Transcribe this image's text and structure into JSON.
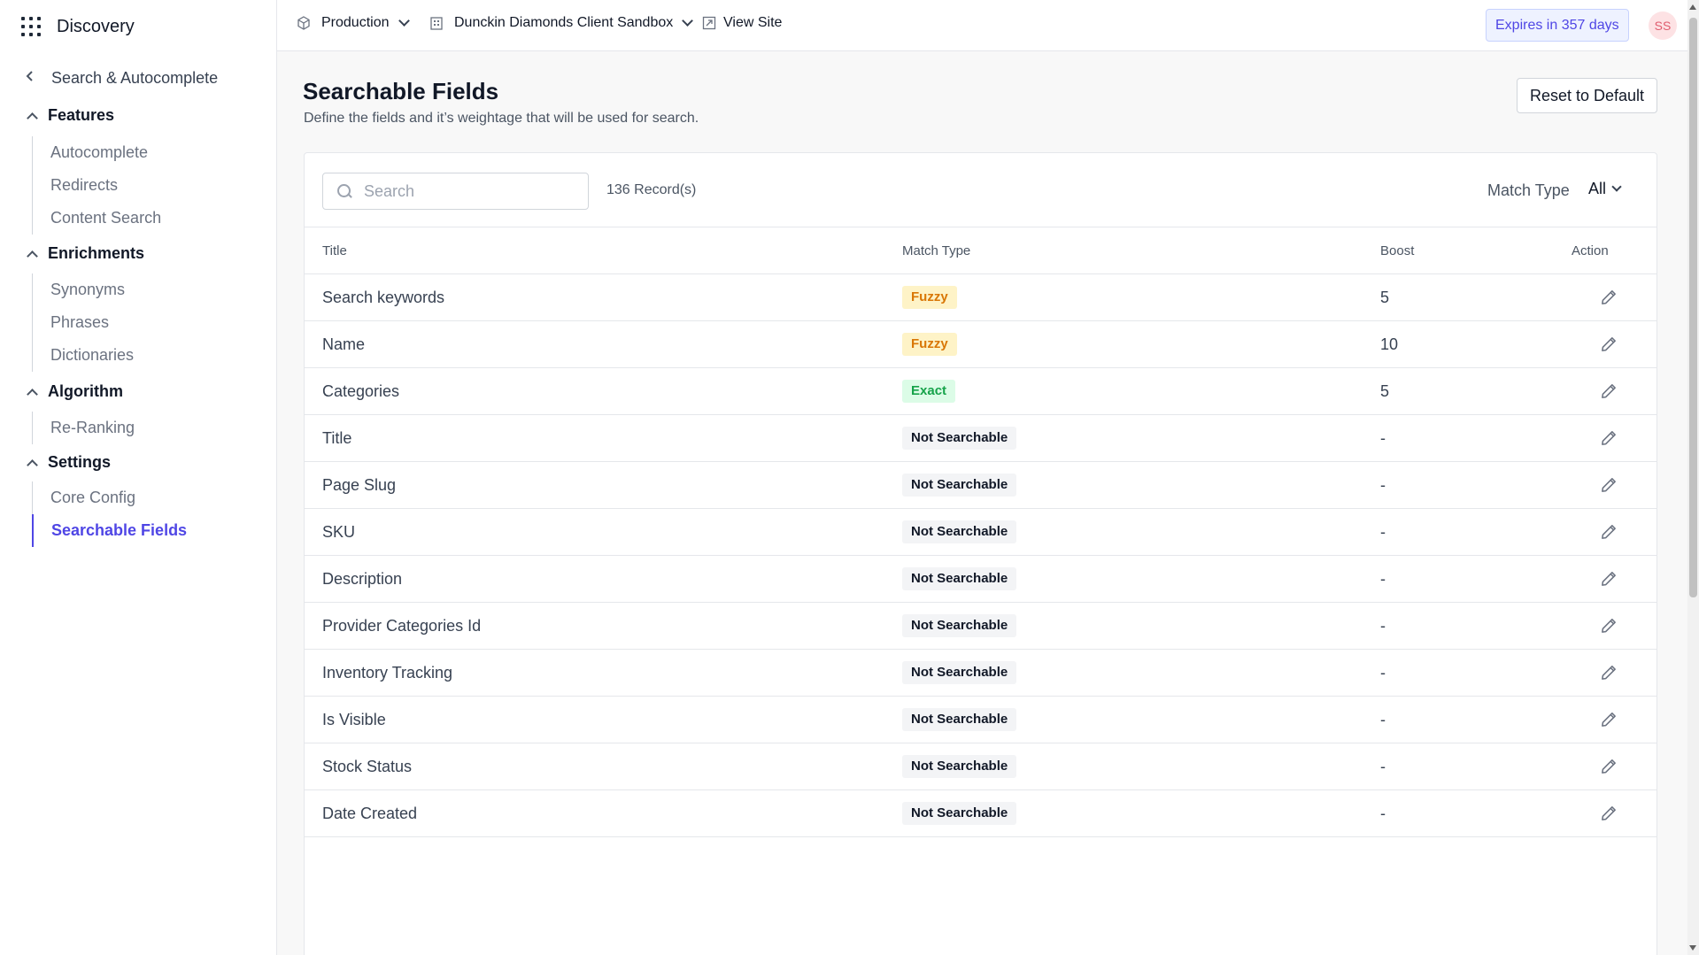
{
  "app": {
    "name": "Discovery"
  },
  "sidebar": {
    "back_label": "Search & Autocomplete",
    "sections": [
      {
        "label": "Features",
        "items": [
          "Autocomplete",
          "Redirects",
          "Content Search"
        ]
      },
      {
        "label": "Enrichments",
        "items": [
          "Synonyms",
          "Phrases",
          "Dictionaries"
        ]
      },
      {
        "label": "Algorithm",
        "items": [
          "Re-Ranking"
        ]
      },
      {
        "label": "Settings",
        "items": [
          "Core Config",
          "Searchable Fields"
        ]
      }
    ],
    "active_item": "Searchable Fields"
  },
  "topbar": {
    "environment": "Production",
    "client": "Dunckin Diamonds Client Sandbox",
    "view_site": "View Site",
    "expires": "Expires in 357 days",
    "avatar_initials": "SS"
  },
  "page": {
    "title": "Searchable Fields",
    "subtitle": "Define the fields and it’s weightage that will be used for search.",
    "reset_label": "Reset to Default"
  },
  "toolbar": {
    "search_placeholder": "Search",
    "records": "136 Record(s)",
    "match_type_label": "Match Type",
    "match_type_value": "All"
  },
  "table": {
    "headers": {
      "title": "Title",
      "match_type": "Match Type",
      "boost": "Boost",
      "action": "Action"
    },
    "rows": [
      {
        "title": "Search keywords",
        "match": "Fuzzy",
        "kind": "fuzzy",
        "boost": "5"
      },
      {
        "title": "Name",
        "match": "Fuzzy",
        "kind": "fuzzy",
        "boost": "10"
      },
      {
        "title": "Categories",
        "match": "Exact",
        "kind": "exact",
        "boost": "5"
      },
      {
        "title": "Title",
        "match": "Not Searchable",
        "kind": "not",
        "boost": "-"
      },
      {
        "title": "Page Slug",
        "match": "Not Searchable",
        "kind": "not",
        "boost": "-"
      },
      {
        "title": "SKU",
        "match": "Not Searchable",
        "kind": "not",
        "boost": "-"
      },
      {
        "title": "Description",
        "match": "Not Searchable",
        "kind": "not",
        "boost": "-"
      },
      {
        "title": "Provider Categories Id",
        "match": "Not Searchable",
        "kind": "not",
        "boost": "-"
      },
      {
        "title": "Inventory Tracking",
        "match": "Not Searchable",
        "kind": "not",
        "boost": "-"
      },
      {
        "title": "Is Visible",
        "match": "Not Searchable",
        "kind": "not",
        "boost": "-"
      },
      {
        "title": "Stock Status",
        "match": "Not Searchable",
        "kind": "not",
        "boost": "-"
      },
      {
        "title": "Date Created",
        "match": "Not Searchable",
        "kind": "not",
        "boost": "-"
      }
    ]
  },
  "colors": {
    "accent": "#4f46e5",
    "fuzzy_bg": "#fef3c7",
    "fuzzy_fg": "#d97706",
    "exact_bg": "#dcfce7",
    "exact_fg": "#16a34a"
  }
}
